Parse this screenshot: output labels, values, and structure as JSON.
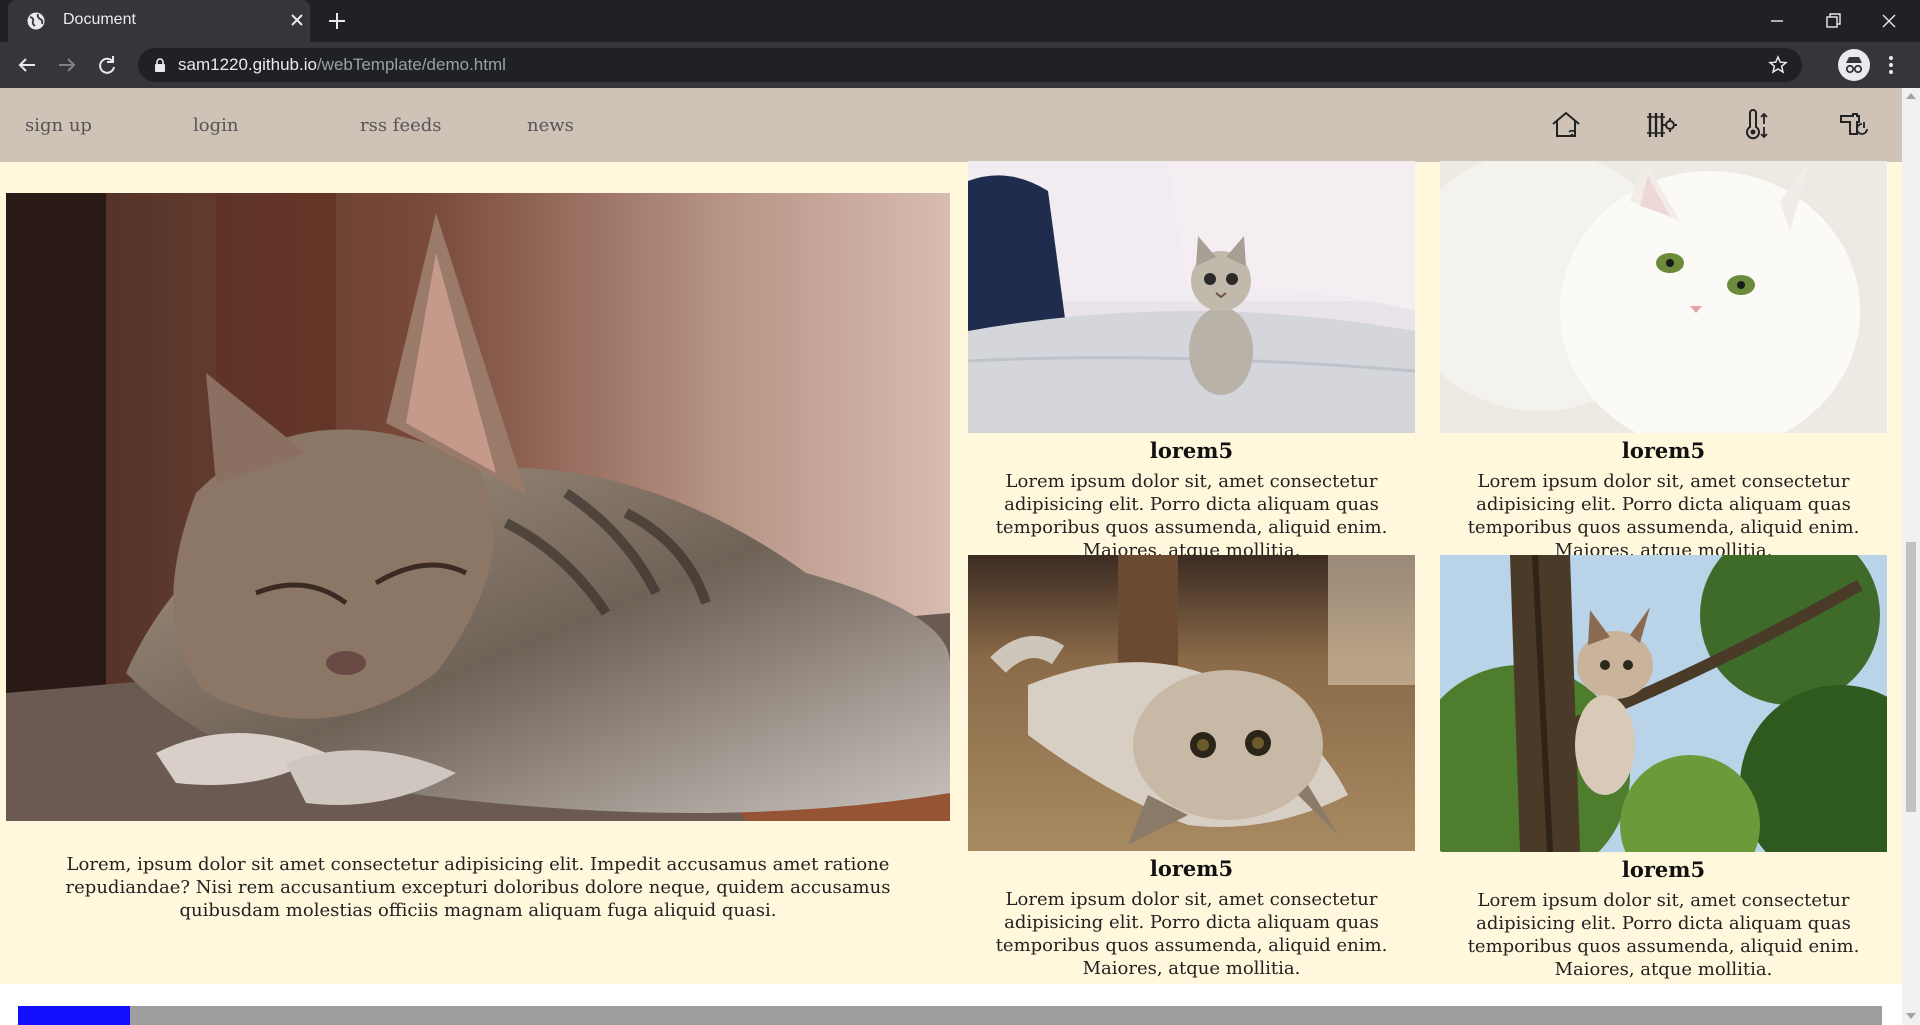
{
  "browser": {
    "tab_title": "Document",
    "url_host": "sam1220.github.io",
    "url_path": "/webTemplate/demo.html"
  },
  "nav": {
    "links": [
      "sign up",
      "login",
      "rss feeds",
      "news"
    ],
    "icons": [
      "smart-home-icon",
      "radiator-settings-icon",
      "thermometer-icon",
      "faucet-power-icon"
    ]
  },
  "feature": {
    "image": "sleeping-tabby-kitten",
    "text": "Lorem, ipsum dolor sit amet consectetur adipisicing elit. Impedit accusamus amet ratione repudiandae? Nisi rem accusantium excepturi doloribus dolore neque, quidem accusamus quibusdam molestias officiis magnam aliquam fuga aliquid quasi."
  },
  "cards": [
    {
      "image": "kitten-on-bed",
      "title": "lorem5",
      "text": "Lorem ipsum dolor sit, amet consectetur adipisicing elit. Porro dicta aliquam quas temporibus quos assumenda, aliquid enim. Maiores, atque mollitia."
    },
    {
      "image": "white-cat",
      "title": "lorem5",
      "text": "Lorem ipsum dolor sit, amet consectetur adipisicing elit. Porro dicta aliquam quas temporibus quos assumenda, aliquid enim. Maiores, atque mollitia."
    },
    {
      "image": "cat-upside-down",
      "title": "lorem5",
      "text": "Lorem ipsum dolor sit, amet consectetur adipisicing elit. Porro dicta aliquam quas temporibus quos assumenda, aliquid enim. Maiores, atque mollitia."
    },
    {
      "image": "kitten-in-tree",
      "title": "lorem5",
      "text": "Lorem ipsum dolor sit, amet consectetur adipisicing elit. Porro dicta aliquam quas temporibus quos assumenda, aliquid enim. Maiores, atque mollitia."
    }
  ],
  "progress": {
    "fraction": 0.003
  },
  "colors": {
    "page_bg": "#fff8dc",
    "navbar_bg": "#cfc3b8",
    "progress_fill": "#1010ff",
    "progress_track": "#9e9e9e"
  }
}
